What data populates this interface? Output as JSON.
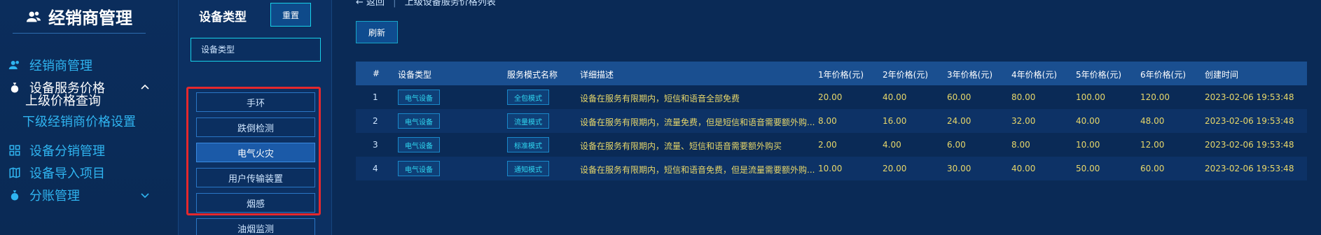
{
  "brand": {
    "title": "经销商管理"
  },
  "sidebar": {
    "items": [
      {
        "label": "经销商管理",
        "icon": "users-icon"
      },
      {
        "label": "设备服务价格",
        "icon": "money-bag-icon",
        "expanded": true
      },
      {
        "label": "设备分销管理",
        "icon": "grid-icon"
      },
      {
        "label": "设备导入项目",
        "icon": "map-icon"
      },
      {
        "label": "分账管理",
        "icon": "money-bag-icon"
      }
    ],
    "sub_items": [
      {
        "label": "上级价格查询",
        "active": true
      },
      {
        "label": "下级经销商价格设置"
      }
    ]
  },
  "filter": {
    "title": "设备类型",
    "reset_label": "重置",
    "input_placeholder": "设备类型",
    "types": [
      "手环",
      "跌倒检测",
      "电气火灾",
      "用户传输装置",
      "烟感",
      "油烟监测"
    ],
    "active_type": "电气火灾"
  },
  "main": {
    "back_label": "← 返回",
    "page_title": "上级设备服务价格列表",
    "refresh_label": "刷新"
  },
  "table": {
    "headers": [
      "#",
      "设备类型",
      "服务模式名称",
      "详细描述",
      "1年价格(元)",
      "2年价格(元)",
      "3年价格(元)",
      "4年价格(元)",
      "5年价格(元)",
      "6年价格(元)",
      "创建时间"
    ],
    "rows": [
      {
        "idx": "1",
        "type": "电气设备",
        "mode": "全包模式",
        "desc": "设备在服务有限期内，短信和语音全部免费",
        "p1": "20.00",
        "p2": "40.00",
        "p3": "60.00",
        "p4": "80.00",
        "p5": "100.00",
        "p6": "120.00",
        "created": "2023-02-06 19:53:48"
      },
      {
        "idx": "2",
        "type": "电气设备",
        "mode": "流量模式",
        "desc": "设备在服务有限期内，流量免费，但是短信和语音需要额外购...",
        "p1": "8.00",
        "p2": "16.00",
        "p3": "24.00",
        "p4": "32.00",
        "p5": "40.00",
        "p6": "48.00",
        "created": "2023-02-06 19:53:48"
      },
      {
        "idx": "3",
        "type": "电气设备",
        "mode": "标准模式",
        "desc": "设备在服务有限期内，流量、短信和语音需要额外购买",
        "p1": "2.00",
        "p2": "4.00",
        "p3": "6.00",
        "p4": "8.00",
        "p5": "10.00",
        "p6": "12.00",
        "created": "2023-02-06 19:53:48"
      },
      {
        "idx": "4",
        "type": "电气设备",
        "mode": "通知模式",
        "desc": "设备在服务有限期内，短信和语音免费，但是流量需要额外购...",
        "p1": "10.00",
        "p2": "20.00",
        "p3": "30.00",
        "p4": "40.00",
        "p5": "50.00",
        "p6": "60.00",
        "created": "2023-02-06 19:53:48"
      }
    ]
  },
  "colors": {
    "accent": "#17d1e8",
    "text_value": "#e7d76a",
    "highlight_border": "#e5282d",
    "header_bg": "#1a4f90"
  }
}
